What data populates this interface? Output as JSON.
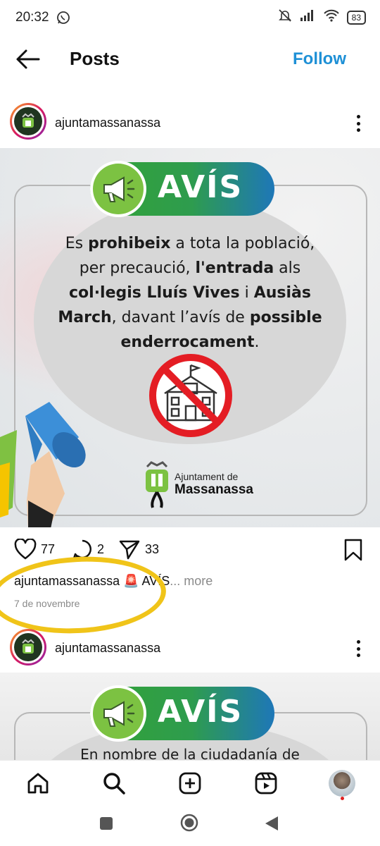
{
  "status_bar": {
    "time": "20:32",
    "battery": "83"
  },
  "header": {
    "title": "Posts",
    "follow_label": "Follow"
  },
  "post1": {
    "username": "ajuntamassanassa",
    "image": {
      "banner": "AVÍS",
      "notice_parts": [
        {
          "t": "Es ",
          "b": false
        },
        {
          "t": "prohibeix",
          "b": true
        },
        {
          "t": " a tota la població, per precaució, ",
          "b": false
        },
        {
          "t": "l'entrada",
          "b": true
        },
        {
          "t": " als ",
          "b": false
        },
        {
          "t": "col·legis Lluís Vives",
          "b": true
        },
        {
          "t": " i ",
          "b": false
        },
        {
          "t": "Ausiàs March",
          "b": true
        },
        {
          "t": ", davant l’avís de ",
          "b": false
        },
        {
          "t": "possible enderrocament",
          "b": true
        },
        {
          "t": ".",
          "b": false
        }
      ],
      "logo_line1": "Ajuntament de",
      "logo_line2": "Massanassa"
    },
    "likes": "77",
    "comments": "2",
    "shares": "33",
    "caption_user": "ajuntamassanassa",
    "caption_text": "🚨 AVÍS",
    "caption_more": "... more",
    "date": "7 de novembre"
  },
  "post2": {
    "username": "ajuntamassanassa",
    "banner": "AVÍS",
    "notice": "En nombre de la ciudadanía de"
  },
  "colors": {
    "follow": "#1e90d6",
    "highlight": "#f0c419",
    "banner_green": "#33a335",
    "banner_blue": "#1e77b8"
  },
  "icons": {
    "bottom_nav": [
      "home-icon",
      "search-icon",
      "create-icon",
      "reels-icon",
      "profile-icon"
    ],
    "actions": [
      "heart-icon",
      "comment-icon",
      "share-icon",
      "bookmark-icon"
    ]
  }
}
